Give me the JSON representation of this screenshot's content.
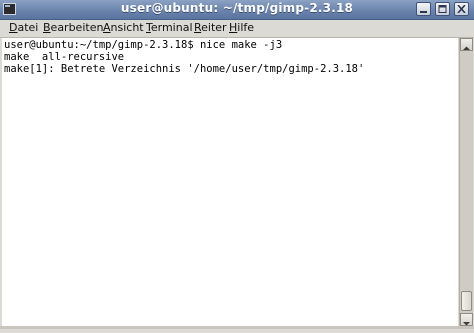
{
  "window": {
    "title": "user@ubuntu: ~/tmp/gimp-2.3.18",
    "controls": [
      "minimize",
      "maximize",
      "close"
    ]
  },
  "menu": [
    {
      "first": "D",
      "rest": "atei"
    },
    {
      "first": "B",
      "rest": "earbeiten"
    },
    {
      "first": "A",
      "rest": "nsicht"
    },
    {
      "first": "T",
      "rest": "erminal"
    },
    {
      "first": "R",
      "rest": "eiter"
    },
    {
      "first": "H",
      "rest": "ilfe"
    }
  ],
  "terminal": {
    "lines": [
      "user@ubuntu:~/tmp/gimp-2.3.18$ nice make -j3",
      "make  all-recursive",
      "make[1]: Betrete Verzeichnis '/home/user/tmp/gimp-2.3.18'"
    ]
  },
  "colors": {
    "titlebar": "#6b84ad",
    "terminal_bg": "#ffffff",
    "terminal_fg": "#000000",
    "chrome": "#dcdad5"
  }
}
